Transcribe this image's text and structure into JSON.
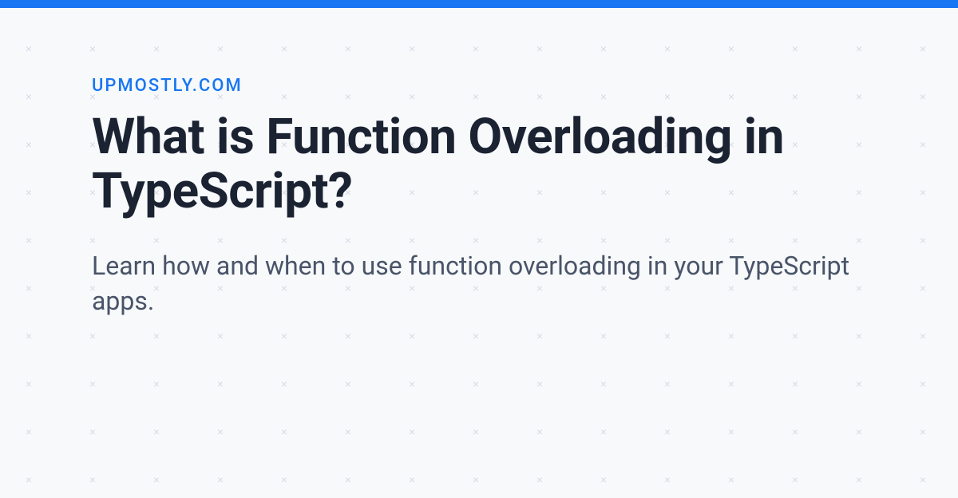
{
  "header": {
    "site_name": "UPMOSTLY.COM"
  },
  "article": {
    "title": "What is Function Overloading in TypeScript?",
    "subtitle": "Learn how and when to use function overloading in your TypeScript apps."
  }
}
